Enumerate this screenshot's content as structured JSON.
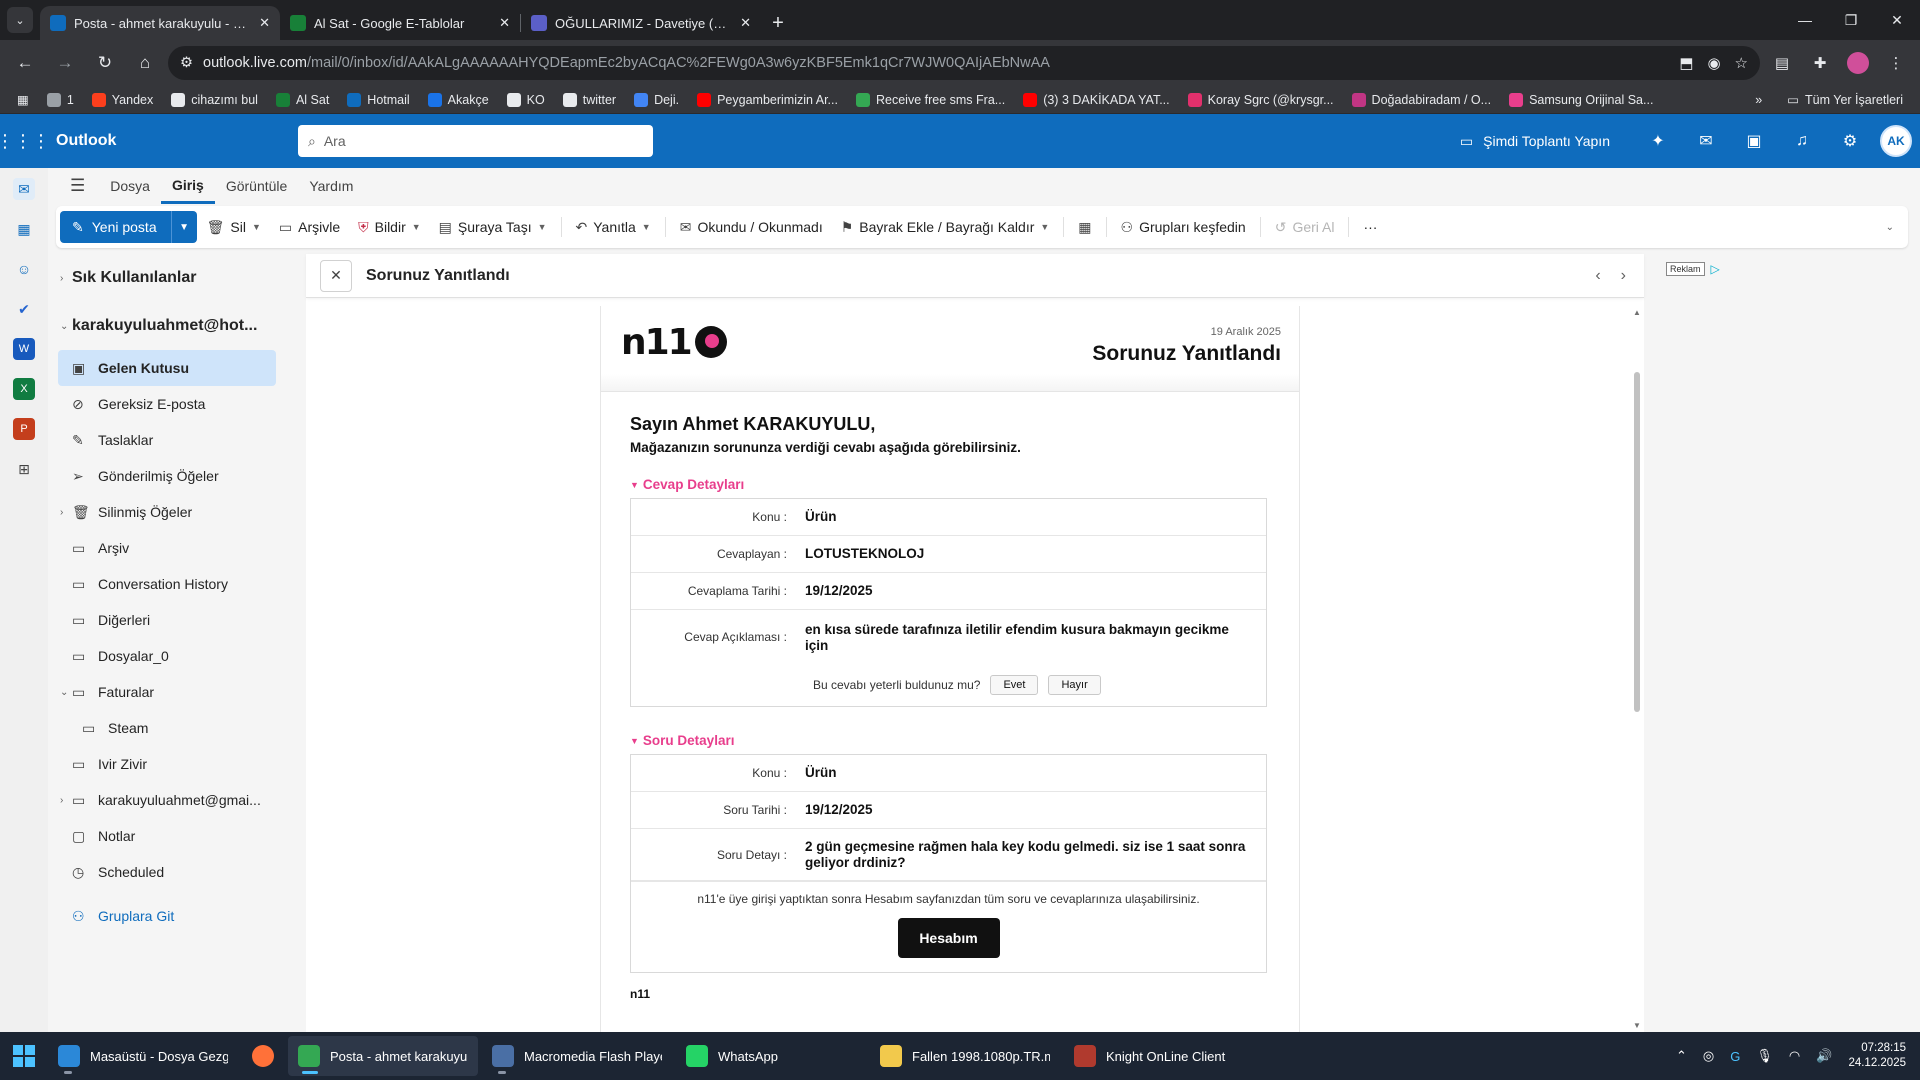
{
  "browser": {
    "tabs": [
      {
        "title": "Posta - ahmet karakuyulu - Outlook",
        "active": true,
        "color": "#0f6cbd"
      },
      {
        "title": "Al Sat - Google E-Tablolar",
        "active": false,
        "color": "#188038"
      },
      {
        "title": "OĞULLARIMIZ - Davetiye (A6)",
        "active": false,
        "color": "#5b5fc7"
      }
    ],
    "url_host": "outlook.live.com",
    "url_path": "/mail/0/inbox/id/AAkALgAAAAAAHYQDEapmEc2byACqAC%2FEWg0A3w6yzKBF5Emk1qCr7WJW0QAIjAEbNwAA",
    "bookmarks": [
      {
        "label": "1",
        "color": "#9aa0a6"
      },
      {
        "label": "Yandex",
        "color": "#fc3f1d"
      },
      {
        "label": "cihazımı bul",
        "color": "#e8eaed"
      },
      {
        "label": "Al Sat",
        "color": "#188038"
      },
      {
        "label": "Hotmail",
        "color": "#0f6cbd"
      },
      {
        "label": "Akakçe",
        "color": "#1a73e8"
      },
      {
        "label": "KO",
        "color": "#e8eaed"
      },
      {
        "label": "twitter",
        "color": "#e8eaed"
      },
      {
        "label": "Deji.",
        "color": "#4285f4"
      },
      {
        "label": "Peygamberimizin Ar...",
        "color": "#ff0000"
      },
      {
        "label": "Receive free sms Fra...",
        "color": "#34a853"
      },
      {
        "label": "(3) 3 DAKİKADA YAT...",
        "color": "#ff0000"
      },
      {
        "label": "Koray Sgrc (@krysgr...",
        "color": "#e1306c"
      },
      {
        "label": "Doğadabiradam / O...",
        "color": "#c13584"
      },
      {
        "label": "Samsung Orijinal Sa...",
        "color": "#e83e8c"
      }
    ],
    "bookmarks_all": "Tüm Yer İşaretleri"
  },
  "outlook": {
    "brand": "Outlook",
    "search_placeholder": "Ara",
    "meet_now": "Şimdi Toplantı Yapın",
    "avatar_initials": "AK",
    "ribbon_tabs": [
      "Dosya",
      "Giriş",
      "Görüntüle",
      "Yardım"
    ],
    "ribbon": {
      "new_mail": "Yeni posta",
      "delete": "Sil",
      "archive": "Arşivle",
      "report": "Bildir",
      "move": "Şuraya Taşı",
      "reply": "Yanıtla",
      "read_unread": "Okundu / Okunmadı",
      "flag": "Bayrak Ekle / Bayrağı Kaldır",
      "groups": "Grupları keşfedin",
      "undo": "Geri Al",
      "more": "···"
    },
    "folders": {
      "favorites": "Sık Kullanılanlar",
      "account": "karakuyuluahmet@hot...",
      "items": [
        {
          "label": "Gelen Kutusu",
          "icon": "inbox-icon",
          "selected": true,
          "chev": ""
        },
        {
          "label": "Gereksiz E-posta",
          "icon": "junk-icon",
          "chev": ""
        },
        {
          "label": "Taslaklar",
          "icon": "drafts-icon",
          "chev": ""
        },
        {
          "label": "Gönderilmiş Öğeler",
          "icon": "sent-icon",
          "chev": ""
        },
        {
          "label": "Silinmiş Öğeler",
          "icon": "trash-icon",
          "chev": "›"
        },
        {
          "label": "Arşiv",
          "icon": "archive-icon",
          "chev": ""
        },
        {
          "label": "Conversation History",
          "icon": "folder-icon",
          "chev": ""
        },
        {
          "label": "Diğerleri",
          "icon": "folder-icon",
          "chev": ""
        },
        {
          "label": "Dosyalar_0",
          "icon": "folder-icon",
          "chev": ""
        },
        {
          "label": "Faturalar",
          "icon": "folder-icon",
          "chev": "⌄"
        },
        {
          "label": "Steam",
          "icon": "folder-icon",
          "chev": "",
          "indent": true
        },
        {
          "label": "Ivir Zivir",
          "icon": "folder-icon",
          "chev": ""
        },
        {
          "label": "karakuyuluahmet@gmai...",
          "icon": "folder-icon",
          "chev": "›"
        },
        {
          "label": "Notlar",
          "icon": "notes-icon",
          "chev": ""
        },
        {
          "label": "Scheduled",
          "icon": "clock-icon",
          "chev": ""
        }
      ],
      "groups_link": "Gruplara Git"
    },
    "reading": {
      "subject": "Sorunuz Yanıtlandı"
    },
    "ad_label": "Reklam"
  },
  "email": {
    "date": "19 Aralık 2025",
    "title": "Sorunuz Yanıtlandı",
    "greeting": "Sayın Ahmet KARAKUYULU,",
    "intro": "Mağazanızın sorununza verdiği cevabı aşağıda görebilirsiniz.",
    "answer_section": "Cevap Detayları",
    "answer_rows": [
      {
        "k": "Konu :",
        "v": "Ürün"
      },
      {
        "k": "Cevaplayan :",
        "v": "LOTUSTEKNOLOJ"
      },
      {
        "k": "Cevaplama Tarihi :",
        "v": "19/12/2025"
      }
    ],
    "answer_desc_key": "Cevap Açıklaması :",
    "answer_desc": "en kısa sürede tarafınıza iletilir efendim kusura bakmayın gecikme için",
    "feedback_q": "Bu cevabı yeterli buldunuz mu?",
    "feedback_yes": "Evet",
    "feedback_no": "Hayır",
    "question_section": "Soru Detayları",
    "question_rows": [
      {
        "k": "Konu :",
        "v": "Ürün"
      },
      {
        "k": "Soru Tarihi :",
        "v": "19/12/2025"
      }
    ],
    "question_detail_key": "Soru Detayı :",
    "question_detail": "2 gün geçmesine rağmen hala key kodu gelmedi. siz ise 1 saat sonra geliyor drdiniz?",
    "footer_note": "n11'e üye girişi yaptıktan sonra Hesabım sayfanızdan tüm soru ve cevaplarınıza ulaşabilirsiniz.",
    "account_button": "Hesabım",
    "signature": "n11",
    "logo_text": "n11"
  },
  "taskbar": {
    "items": [
      {
        "label": "Masaüstü - Dosya Gezg",
        "color": "#2b88d8",
        "running": true
      },
      {
        "label": "",
        "color": "#ff7139",
        "running": false,
        "icon_only": true
      },
      {
        "label": "Posta - ahmet karakuyu",
        "color": "#34a853",
        "running": true,
        "active": true
      },
      {
        "label": "Macromedia Flash Playe",
        "color": "#4a6fa5",
        "running": true
      },
      {
        "label": "WhatsApp",
        "color": "#25d366",
        "running": false
      },
      {
        "label": "Fallen 1998.1080p.TR.mp",
        "color": "#f2c94c",
        "running": false
      },
      {
        "label": "Knight OnLine Client",
        "color": "#b03a2e",
        "running": false
      }
    ],
    "time": "07:28:15",
    "date": "24.12.2025"
  }
}
